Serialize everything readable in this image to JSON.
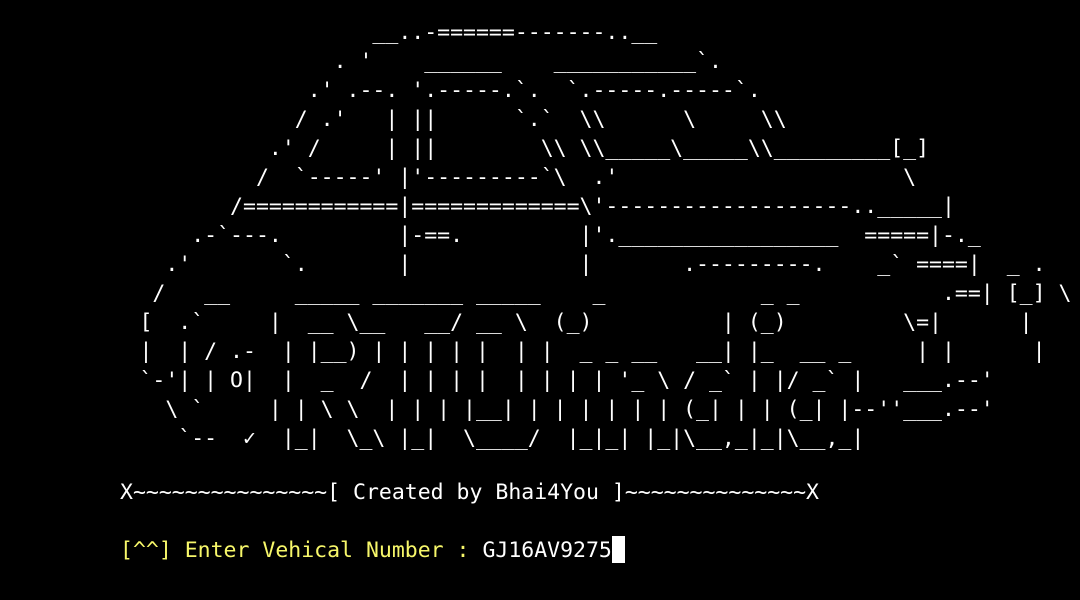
{
  "banner": {
    "art": "                            __..-======-------..__\n                         . '    ______    ___________`.\n                       .' .--. '.-----.`.  `.-----.-----`.\n                      / .'   | ||      `.`  \\\\      \\     \\\\\n                    .' /     | ||        \\\\ \\\\_____\\_____\\\\_________[_]\n                   /  `-----' |'---------`\\  .'                      \\\n                 /============|=============\\'-------------------.._____|\n              .-`---.         |-==.         |'._________________  =====|-._\n            .'       `.       |             |       .---------.    _` ====|  _ .\n           /   __     _____ _______ _____    _            _ _           .==| [_] \\\n          [  .`     |  __ \\__   __/ __ \\  (_)          | (_)         \\=|      |\n          |  | / .-  | |__) | | | | |  | |  _ _ __   __| |_  __ _     | |      |\n          `-'| | O|  |  _  /  | | | |  | | | | '_ \\ / _` | |/ _` |   ___.--'\n            \\ `     | | \\ \\  | | | |__| | | | | | | (_| | | (_| |--''___.--'\n             `--  ✓  |_|  \\_\\ |_|  \\____/  |_|_| |_|\\__,_|_|\\__,_|"
  },
  "credit": {
    "line": "X~~~~~~~~~~~~~~~[ Created by Bhai4You ]~~~~~~~~~~~~~~X"
  },
  "prompt": {
    "label": "[^^] Enter Vehical Number : ",
    "value": "GJ16AV9275"
  },
  "colors": {
    "background": "#000000",
    "text": "#ffffff",
    "prompt": "#f7f76a"
  }
}
